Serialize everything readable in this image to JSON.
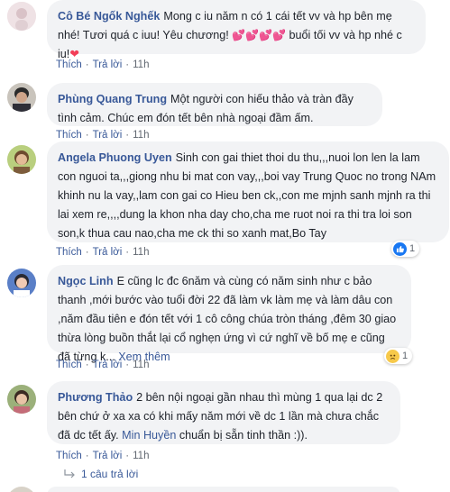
{
  "comments": [
    {
      "name": "Cô Bé Ngốk Nghếk",
      "text_a": "Mong c iu năm n có 1 cái tết vv và hp bên mẹ nhé! Tươi quá c iuu! Yêu chương! ",
      "text_b": " buổi tối vv và hp nhé c iu!",
      "actions": [
        "Thích",
        "Trả lời",
        "11h"
      ]
    },
    {
      "name": "Phùng Quang Trung",
      "text": "Một người con hiếu thảo và tràn đầy tình cảm. Chúc em đón tết bên nhà ngoại đầm ấm.",
      "actions": [
        "Thích",
        "Trả lời",
        "11h"
      ]
    },
    {
      "name": "Angela Phuong Uyen",
      "text": "Sinh con gai thiet thoi du thu,,,nuoi lon len la lam con nguoi ta,,,giong nhu bi mat con vay,,,boi vay Trung Quoc no trong NAm khinh nu la vay,,lam con gai co Hieu ben ck,,con me mjnh sanh mjnh ra thi lai xem re,,,,dung la khon nha day cho,cha me ruot noi ra thi tra loi son son,k thua cau nao,cha me ck thi so xanh mat,Bo Tay",
      "actions": [
        "Thích",
        "Trả lời",
        "11h"
      ],
      "reaction_count": "1"
    },
    {
      "name": "Ngọc Linh",
      "text": "E cũng lc đc 6năm và cùng có năm sinh như c bảo thanh ,mới bước vào tuổi đời 22 đã làm vk làm mẹ và làm dâu con ,năm đầu tiên e đón tết với 1 cô công chúa tròn tháng ,đêm 30 giao thừa lòng buồn thắt lại cổ nghẹn ứng vì cứ nghĩ về bố mẹ e cũng đã từng k...",
      "see_more": "Xem thêm",
      "actions": [
        "Thích",
        "Trả lời",
        "11h"
      ],
      "reaction_count": "1"
    },
    {
      "name": "Phương Thảo",
      "text": "2 bên nội ngoại gần nhau thì mùng 1 qua lại dc 2 bên chứ ở xa xa có khi mấy năm mới về dc 1 lần mà chưa chắc đã dc tết ấy. ",
      "mention": "Min Huyền",
      "text_after": " chuẩn bị sẵn tinh thần :)).",
      "actions": [
        "Thích",
        "Trả lời",
        "11h"
      ]
    }
  ],
  "reply_link": "1 câu trả lời",
  "colors": {
    "link": "#385898",
    "bubble": "#f2f3f5",
    "like": "#1877f2",
    "heart": "#f33e58"
  }
}
